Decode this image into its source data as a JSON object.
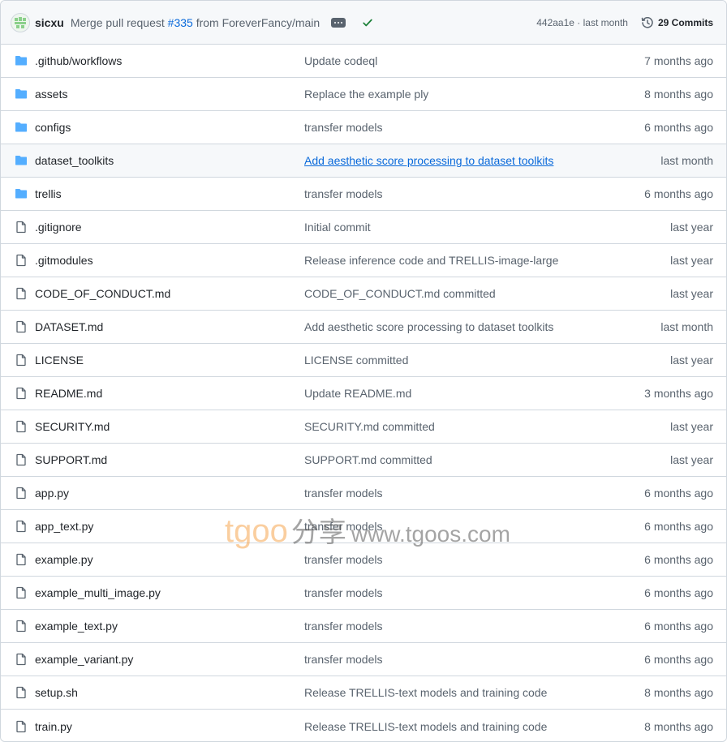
{
  "header": {
    "author": "sicxu",
    "message_prefix": "Merge pull request ",
    "pr_number": "#335",
    "message_suffix": " from ForeverFancy/main",
    "sha": "442aa1e",
    "sha_sep": " · ",
    "time": "last month",
    "commits_label": "29 Commits"
  },
  "colors": {
    "folder": "#54aeff",
    "link": "#0969da",
    "success": "#1a7f37",
    "muted": "#59636e"
  },
  "files": [
    {
      "type": "folder",
      "name": ".github/workflows",
      "message": "Update codeql",
      "date": "7 months ago"
    },
    {
      "type": "folder",
      "name": "assets",
      "message": "Replace the example ply",
      "date": "8 months ago"
    },
    {
      "type": "folder",
      "name": "configs",
      "message": "transfer models",
      "date": "6 months ago"
    },
    {
      "type": "folder",
      "name": "dataset_toolkits",
      "message": "Add aesthetic score processing to dataset toolkits",
      "date": "last month"
    },
    {
      "type": "folder",
      "name": "trellis",
      "message": "transfer models",
      "date": "6 months ago"
    },
    {
      "type": "file",
      "name": ".gitignore",
      "message": "Initial commit",
      "date": "last year"
    },
    {
      "type": "file",
      "name": ".gitmodules",
      "message": "Release inference code and TRELLIS-image-large",
      "date": "last year"
    },
    {
      "type": "file",
      "name": "CODE_OF_CONDUCT.md",
      "message": "CODE_OF_CONDUCT.md committed",
      "date": "last year"
    },
    {
      "type": "file",
      "name": "DATASET.md",
      "message": "Add aesthetic score processing to dataset toolkits",
      "date": "last month"
    },
    {
      "type": "file",
      "name": "LICENSE",
      "message": "LICENSE committed",
      "date": "last year"
    },
    {
      "type": "file",
      "name": "README.md",
      "message": "Update README.md",
      "date": "3 months ago"
    },
    {
      "type": "file",
      "name": "SECURITY.md",
      "message": "SECURITY.md committed",
      "date": "last year"
    },
    {
      "type": "file",
      "name": "SUPPORT.md",
      "message": "SUPPORT.md committed",
      "date": "last year"
    },
    {
      "type": "file",
      "name": "app.py",
      "message": "transfer models",
      "date": "6 months ago"
    },
    {
      "type": "file",
      "name": "app_text.py",
      "message": "transfer models",
      "date": "6 months ago"
    },
    {
      "type": "file",
      "name": "example.py",
      "message": "transfer models",
      "date": "6 months ago"
    },
    {
      "type": "file",
      "name": "example_multi_image.py",
      "message": "transfer models",
      "date": "6 months ago"
    },
    {
      "type": "file",
      "name": "example_text.py",
      "message": "transfer models",
      "date": "6 months ago"
    },
    {
      "type": "file",
      "name": "example_variant.py",
      "message": "transfer models",
      "date": "6 months ago"
    },
    {
      "type": "file",
      "name": "setup.sh",
      "message": "Release TRELLIS-text models and training code",
      "date": "8 months ago"
    },
    {
      "type": "file",
      "name": "train.py",
      "message": "Release TRELLIS-text models and training code",
      "date": "8 months ago"
    }
  ],
  "watermark": {
    "brand": "tgoo",
    "cn": "分享",
    "url": "www.tgoos.com"
  }
}
